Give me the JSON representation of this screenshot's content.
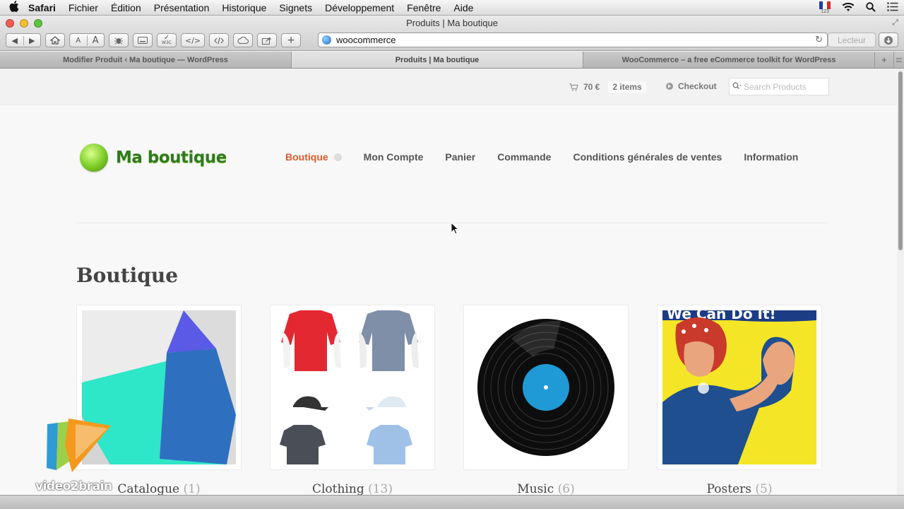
{
  "menubar": {
    "app": "Safari",
    "items": [
      "Fichier",
      "Édition",
      "Présentation",
      "Historique",
      "Signets",
      "Développement",
      "Fenêtre",
      "Aide"
    ],
    "flag_colors": [
      "#1a3da8",
      "#ffffff",
      "#d8262a"
    ],
    "flag_caption": "123"
  },
  "window": {
    "title": "Produits | Ma boutique",
    "traffic_colors": [
      "#f05b52",
      "#f4bd33",
      "#5ec43c"
    ]
  },
  "toolbar": {
    "nav_back": "◀",
    "nav_fwd": "▶",
    "font_small": "A",
    "font_large": "A",
    "validate_caption": "W3C",
    "code_label": "</>",
    "add_label": "+",
    "reader_label": "Lecteur"
  },
  "address": {
    "url": "woocommerce"
  },
  "tabs": [
    {
      "label": "Modifier Produit ‹ Ma boutique — WordPress",
      "active": false
    },
    {
      "label": "Produits | Ma boutique",
      "active": true
    },
    {
      "label": "WooCommerce – a free eCommerce toolkit for WordPress",
      "active": false
    }
  ],
  "tab_plus": "+",
  "header": {
    "cart_total": "70 €",
    "cart_items": "2 items",
    "checkout_label": "Checkout",
    "search_placeholder": "Search Products"
  },
  "site": {
    "name": "Ma boutique",
    "brand_color": "#2f7a1d",
    "accent_color": "#e0592a"
  },
  "nav": {
    "items": [
      "Boutique",
      "Mon Compte",
      "Panier",
      "Commande",
      "Conditions générales de ventes",
      "Information"
    ],
    "current_index": 0
  },
  "page": {
    "title": "Boutique"
  },
  "products": [
    {
      "name": "Catalogue",
      "count": "(1)",
      "icon": "catalogue-image"
    },
    {
      "name": "Clothing",
      "count": "(13)",
      "icon": "clothing-image"
    },
    {
      "name": "Music",
      "count": "(6)",
      "icon": "vinyl-record-image"
    },
    {
      "name": "Posters",
      "count": "(5)",
      "icon": "poster-image"
    }
  ],
  "poster_text": "We Can Do It!",
  "watermark": {
    "text": "video2brain"
  }
}
